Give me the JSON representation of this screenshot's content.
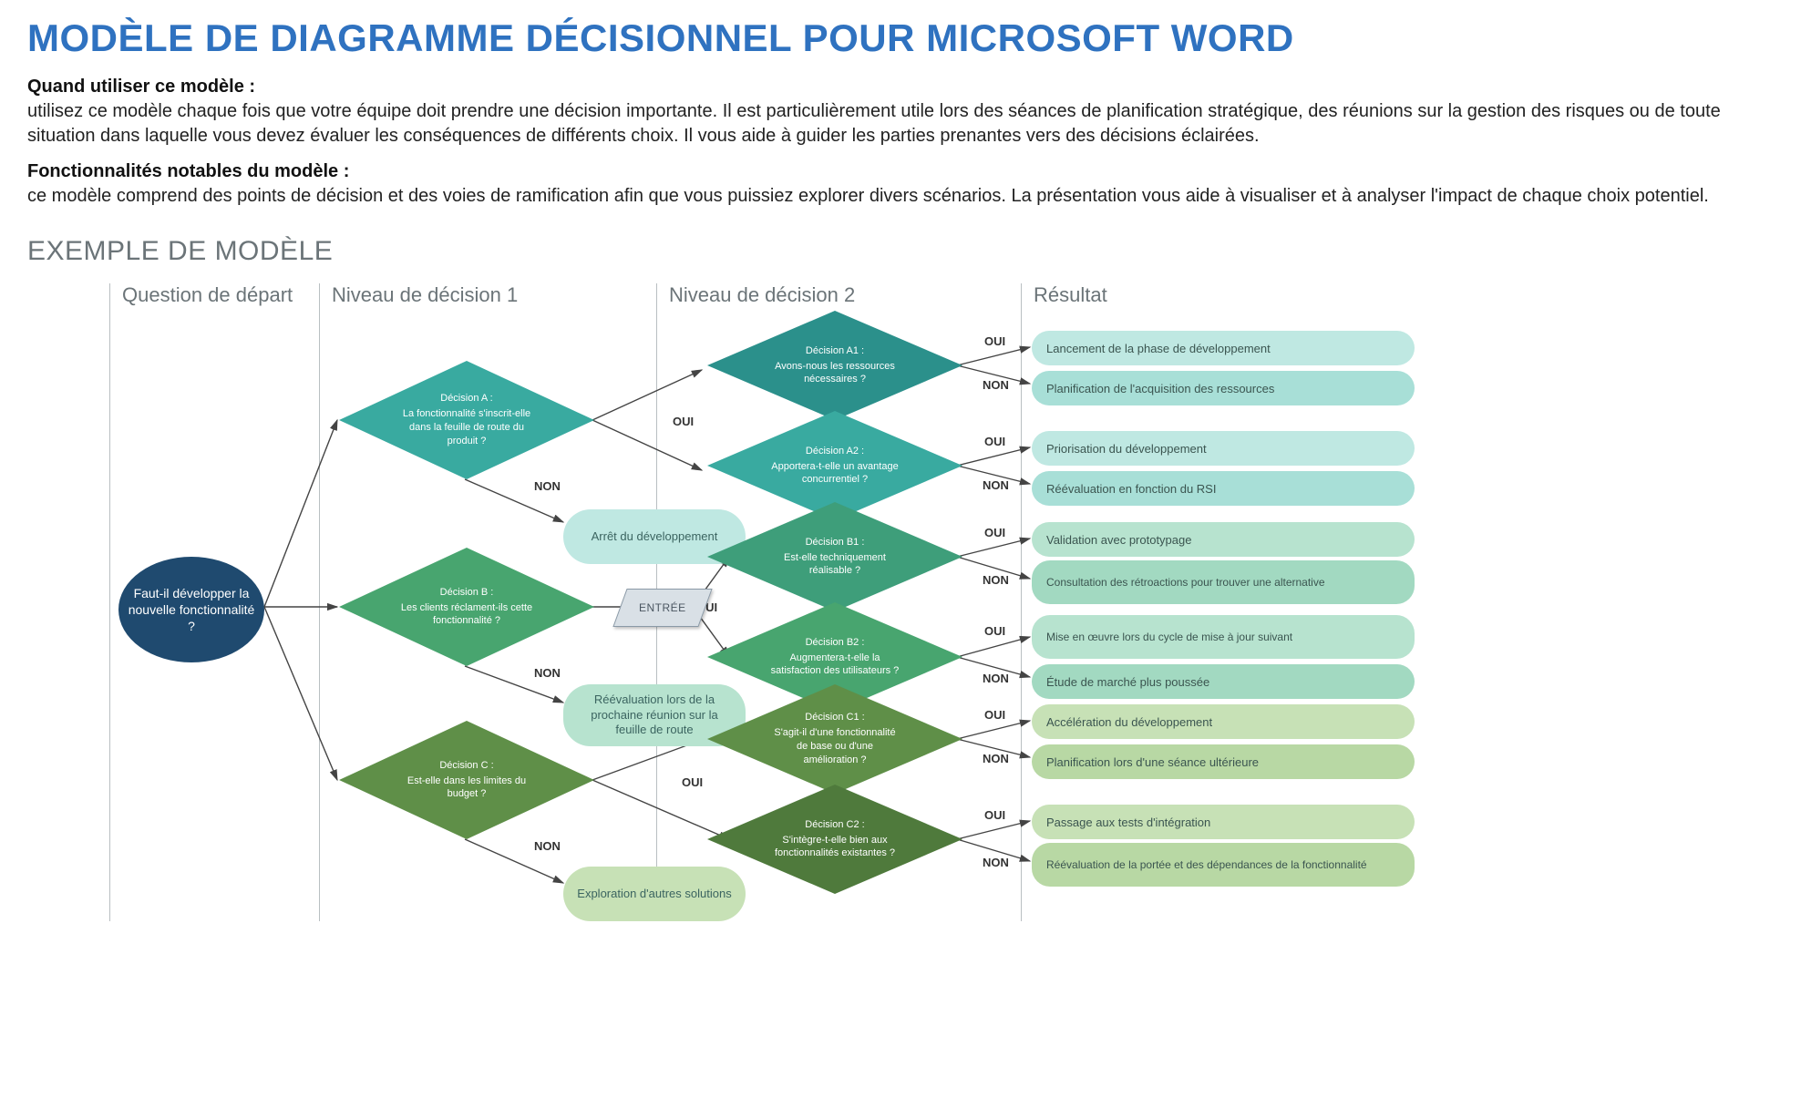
{
  "title": "MODÈLE DE DIAGRAMME DÉCISIONNEL POUR MICROSOFT WORD",
  "intro": {
    "when_label": "Quand utiliser ce modèle :",
    "when_body": "utilisez ce modèle chaque fois que votre équipe doit prendre une décision importante. Il est particulièrement utile lors des séances de planification stratégique, des réunions sur la gestion des risques ou de toute situation dans laquelle vous devez évaluer les conséquences de différents choix. Il vous aide à guider les parties prenantes vers des décisions éclairées.",
    "features_label": "Fonctionnalités notables du modèle :",
    "features_body": "ce modèle comprend des points de décision et des voies de ramification afin que vous puissiez explorer divers scénarios. La présentation vous aide à visualiser et à analyser l'impact de chaque choix potentiel."
  },
  "example_title": "EXEMPLE DE MODÈLE",
  "columns": {
    "start": "Question de départ",
    "level1": "Niveau de décision 1",
    "level2": "Niveau de décision 2",
    "result": "Résultat"
  },
  "labels": {
    "yes": "OUI",
    "no": "NON",
    "entry": "ENTRÉE"
  },
  "start_q": "Faut-il développer la nouvelle fonctionnalité ?",
  "level1": {
    "a": {
      "title": "Décision A :",
      "q": "La fonctionnalité s'inscrit-elle dans la feuille de route du produit ?",
      "no_result": "Arrêt du développement"
    },
    "b": {
      "title": "Décision B :",
      "q": "Les clients réclament-ils cette fonctionnalité ?",
      "no_result": "Réévaluation lors de la prochaine réunion sur la feuille de route"
    },
    "c": {
      "title": "Décision C :",
      "q": "Est-elle dans les limites du budget ?",
      "no_result": "Exploration d'autres solutions"
    }
  },
  "level2": {
    "a1": {
      "title": "Décision A1 :",
      "q": "Avons-nous les ressources nécessaires ?",
      "yes": "Lancement de la phase de développement",
      "no": "Planification de l'acquisition des ressources"
    },
    "a2": {
      "title": "Décision A2 :",
      "q": "Apportera-t-elle un avantage concurrentiel ?",
      "yes": "Priorisation du développement",
      "no": "Réévaluation en fonction du RSI"
    },
    "b1": {
      "title": "Décision B1 :",
      "q": "Est-elle techniquement réalisable ?",
      "yes": "Validation avec prototypage",
      "no": "Consultation des rétroactions pour trouver une alternative"
    },
    "b2": {
      "title": "Décision B2 :",
      "q": "Augmentera-t-elle la satisfaction des utilisateurs ?",
      "yes": "Mise en œuvre lors du cycle de mise à jour suivant",
      "no": "Étude de marché plus poussée"
    },
    "c1": {
      "title": "Décision C1 :",
      "q": "S'agit-il d'une fonctionnalité de base ou d'une amélioration ?",
      "yes": "Accélération du développement",
      "no": "Planification lors d'une séance ultérieure"
    },
    "c2": {
      "title": "Décision C2 :",
      "q": "S'intègre-t-elle bien aux fonctionnalités existantes ?",
      "yes": "Passage aux tests d'intégration",
      "no": "Réévaluation de la portée et des dépendances de la fonctionnalité"
    }
  },
  "colors": {
    "teal_dark": "#2b908b",
    "teal": "#39aaa0",
    "teal_light": "#5abcae",
    "green_sea": "#3e9e7a",
    "green_mid": "#48a56f",
    "olive": "#5f8f48",
    "olive_dark": "#4f7a3c",
    "pill_a": "#bfe8e2",
    "pill_b": "#b7e3cf",
    "pill_c": "#c7e1b6",
    "res_a": "#bfe8e2",
    "res_a2": "#a8dfd7",
    "res_b": "#b7e3cf",
    "res_b2": "#a2d9c1",
    "res_c": "#c7e1b6",
    "res_c2": "#b8d8a4"
  }
}
